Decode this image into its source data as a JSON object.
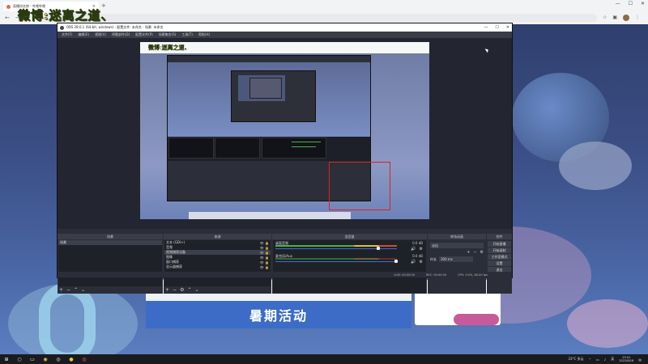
{
  "browser": {
    "tab_title": "直播间名称 - 哔哩哔哩",
    "tab_close": "×",
    "new_tab": "+",
    "win_min": "—",
    "win_max": "☐",
    "win_close": "✕",
    "nav_back": "←",
    "nav_forward": "→",
    "nav_reload": "⟳"
  },
  "watermark": "微博:迷离之道、",
  "obs": {
    "title": "OBS 28.0.1 (64-bit, windows) - 配置文件: 未命名 - 场景: 未命名",
    "menu": [
      "文件(F)",
      "编辑(E)",
      "视图(V)",
      "停靠部件(D)",
      "配置文件(P)",
      "场景集合(S)",
      "工具(T)",
      "帮助(H)"
    ],
    "preview_watermark": "微博:迷离之道、",
    "docks": {
      "scenes": {
        "header": "场景",
        "items": [
          "场景"
        ]
      },
      "sources": {
        "header": "来源",
        "items": [
          "文本 (GDI+)",
          "音频",
          "视频捕获设备",
          "图像",
          "窗口捕获",
          "显示器捕获"
        ]
      },
      "mixer": {
        "header": "混音器",
        "channels": [
          {
            "name": "桌面音频",
            "db": "0.0 dB"
          },
          {
            "name": "麦克风/Aux",
            "db": "0.0 dB"
          }
        ]
      },
      "transitions": {
        "header": "转场动画",
        "type": "淡出",
        "duration_label": "时长",
        "duration": "300 ms"
      },
      "controls": {
        "header": "控件",
        "buttons": [
          "开始直播",
          "开始录制",
          "工作室模式",
          "设置",
          "退出"
        ]
      }
    },
    "status": {
      "live": "LIVE: 00:00:00",
      "rec": "REC: 00:00:00",
      "cpu": "CPU: 0.0%, 60.00 fps"
    }
  },
  "page": {
    "banner_text": "暑期活动"
  },
  "taskbar": {
    "temp": "33°C 多云",
    "lang": "英",
    "time": "23:01",
    "date": "2022/8/18"
  }
}
